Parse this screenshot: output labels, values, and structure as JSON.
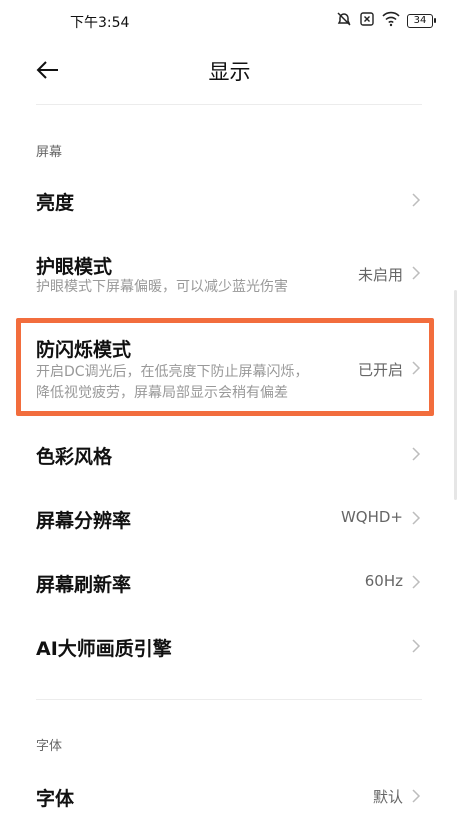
{
  "status_bar": {
    "time": "下午3:54",
    "battery": "34",
    "icons": [
      "alarm-off-icon",
      "sim-disabled-icon",
      "wifi-icon",
      "battery-icon"
    ]
  },
  "header": {
    "title": "显示",
    "back_icon": "back-arrow-icon"
  },
  "sections": {
    "screen": {
      "title": "屏幕",
      "items": [
        {
          "title": "亮度",
          "subtitle": "",
          "value": ""
        },
        {
          "title": "护眼模式",
          "subtitle": "护眼模式下屏幕偏暖，可以减少蓝光伤害",
          "value": "未启用"
        },
        {
          "title": "防闪烁模式",
          "subtitle_line1": "开启DC调光后，在低亮度下防止屏幕闪烁，",
          "subtitle_line2": "降低视觉疲劳，屏幕局部显示会稍有偏差",
          "value": "已开启"
        },
        {
          "title": "色彩风格",
          "subtitle": "",
          "value": ""
        },
        {
          "title": "屏幕分辨率",
          "subtitle": "",
          "value": "WQHD+"
        },
        {
          "title": "屏幕刷新率",
          "subtitle": "",
          "value": "60Hz"
        },
        {
          "title": "AI大师画质引擎",
          "subtitle": "",
          "value": ""
        }
      ]
    },
    "font": {
      "title": "字体",
      "items": [
        {
          "title": "字体",
          "value": "默认"
        }
      ]
    }
  },
  "highlight_color": "#f26d3d"
}
